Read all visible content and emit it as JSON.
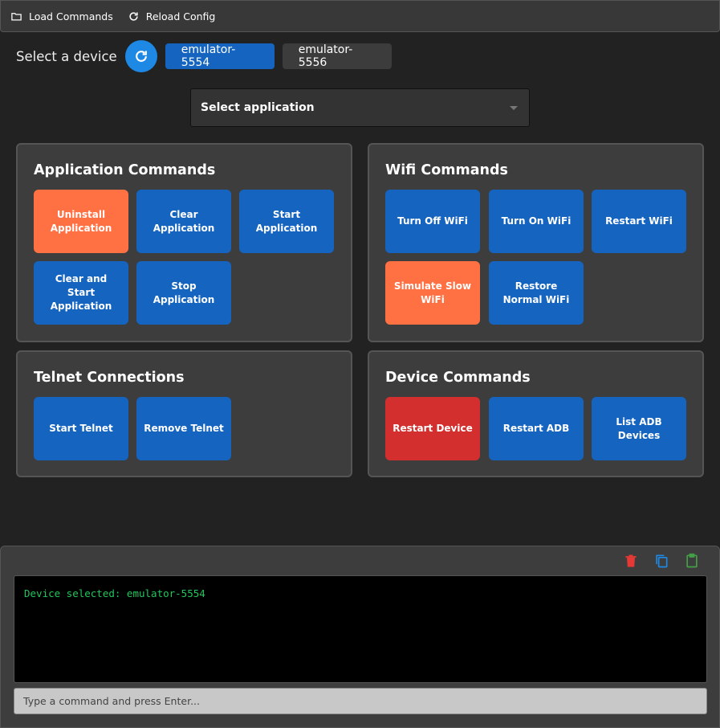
{
  "toolbar": {
    "load_label": "Load Commands",
    "reload_label": "Reload Config"
  },
  "devices": {
    "label": "Select a device",
    "items": [
      "emulator-5554",
      "emulator-5556"
    ],
    "selected": "emulator-5554"
  },
  "app_select": {
    "value": "Select application"
  },
  "panels": {
    "application": {
      "title": "Application Commands",
      "buttons": [
        "Uninstall Application",
        "Clear Application",
        "Start Application",
        "Clear and Start Application",
        "Stop Application"
      ]
    },
    "wifi": {
      "title": "Wifi Commands",
      "buttons": [
        "Turn Off WiFi",
        "Turn On WiFi",
        "Restart WiFi",
        "Simulate Slow WiFi",
        "Restore Normal WiFi"
      ]
    },
    "telnet": {
      "title": "Telnet Connections",
      "buttons": [
        "Start Telnet",
        "Remove Telnet"
      ]
    },
    "device": {
      "title": "Device Commands",
      "buttons": [
        "Restart Device",
        "Restart ADB",
        "List ADB Devices"
      ]
    }
  },
  "console": {
    "output": "Device selected: emulator-5554",
    "placeholder": "Type a command and press Enter..."
  },
  "colors": {
    "primary": "#1565c0",
    "warning": "#ff7043",
    "danger": "#d32f2f",
    "console_text": "#22c55e"
  }
}
